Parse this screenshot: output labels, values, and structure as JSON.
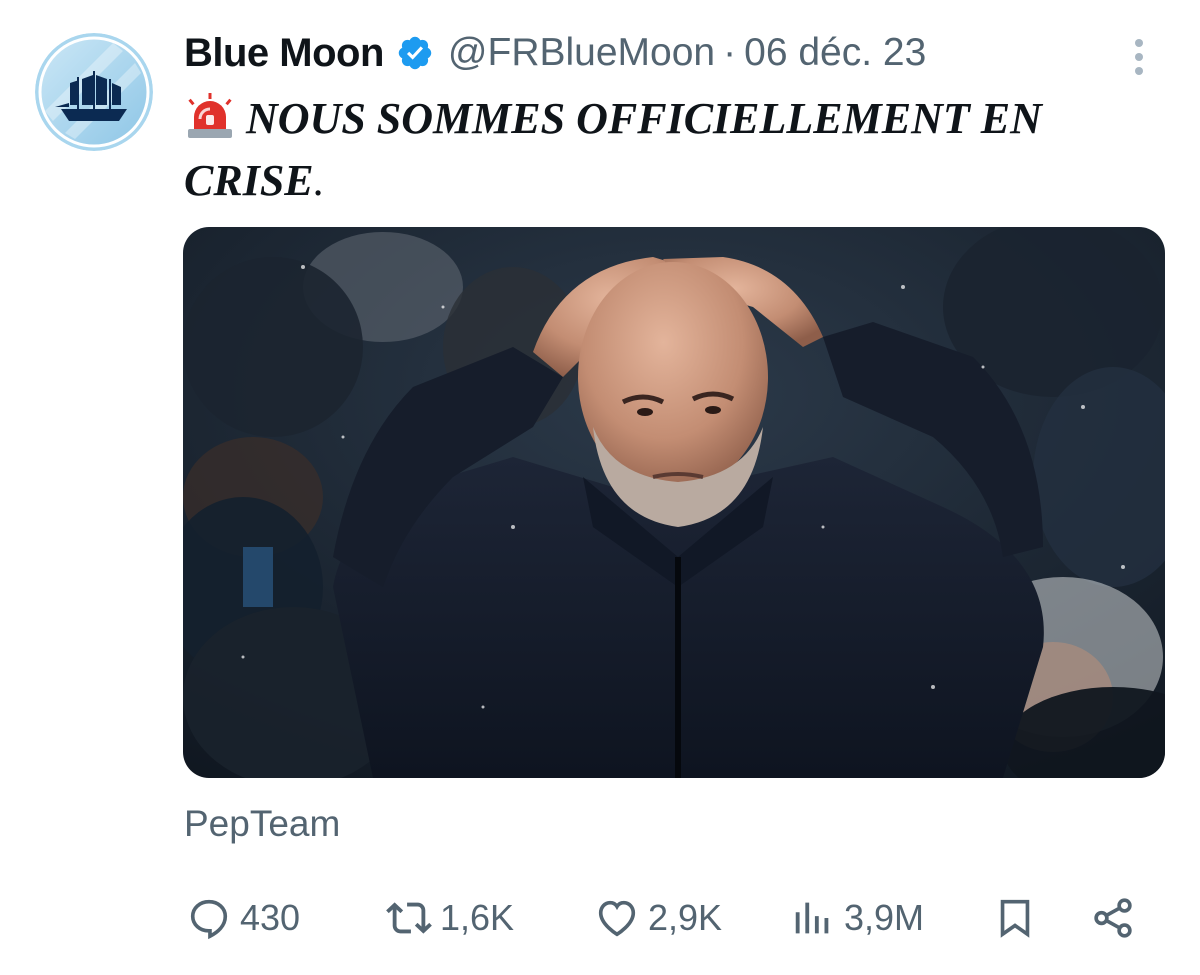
{
  "author": {
    "display_name": "Blue Moon",
    "handle": "@FRBlueMoon",
    "separator": "·",
    "date": "06 déc. 23",
    "verified": true,
    "avatar_icon": "ship-logo-icon"
  },
  "tweet": {
    "emoji": "rotating-light-icon",
    "text": "NOUS SOMMES OFFICIELLEMENT EN CRISE",
    "text_suffix": "."
  },
  "media": {
    "description_icon": "photo-man-hands-on-head"
  },
  "caption": "PepTeam",
  "actions": {
    "replies": "430",
    "reposts": "1,6K",
    "likes": "2,9K",
    "views": "3,9M"
  },
  "colors": {
    "text_primary": "#0f1419",
    "text_secondary": "#536471",
    "verified_blue": "#1d9bf0",
    "avatar_blue": "#9fd0ec"
  }
}
